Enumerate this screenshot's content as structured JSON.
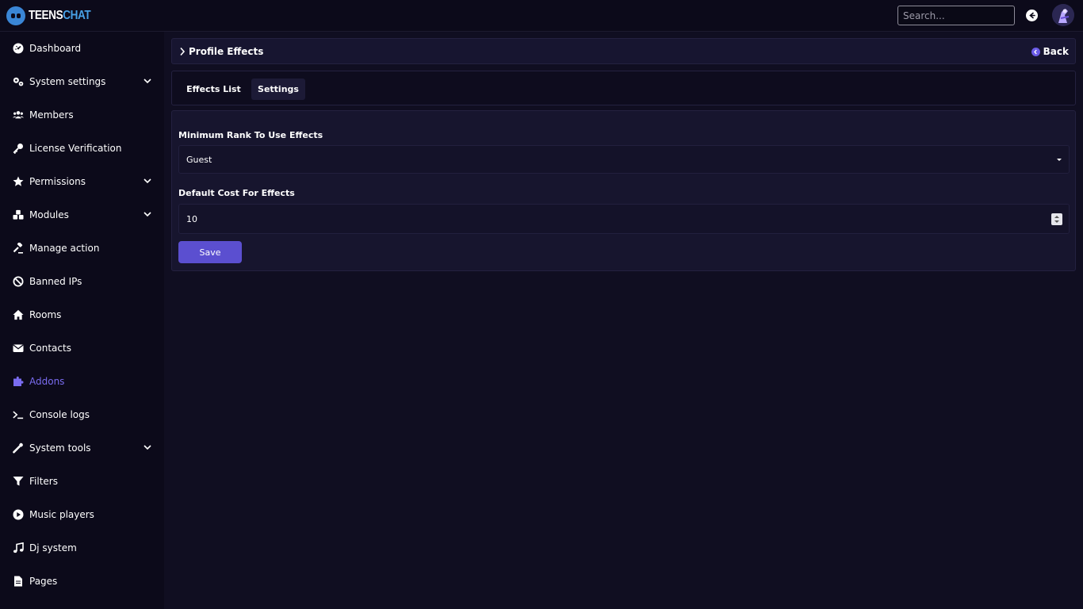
{
  "header": {
    "logo_part1": "TEENS",
    "logo_part2": "CHAT",
    "search_placeholder": "Search..."
  },
  "sidebar": {
    "items": [
      {
        "label": "Dashboard",
        "icon": "gauge-icon",
        "has_chevron": false
      },
      {
        "label": "System settings",
        "icon": "gears-icon",
        "has_chevron": true
      },
      {
        "label": "Members",
        "icon": "users-icon",
        "has_chevron": false
      },
      {
        "label": "License Verification",
        "icon": "key-icon",
        "has_chevron": false
      },
      {
        "label": "Permissions",
        "icon": "star-icon",
        "has_chevron": true
      },
      {
        "label": "Modules",
        "icon": "cubes-icon",
        "has_chevron": true
      },
      {
        "label": "Manage action",
        "icon": "gavel-icon",
        "has_chevron": false
      },
      {
        "label": "Banned IPs",
        "icon": "ban-icon",
        "has_chevron": false
      },
      {
        "label": "Rooms",
        "icon": "home-icon",
        "has_chevron": false
      },
      {
        "label": "Contacts",
        "icon": "envelope-icon",
        "has_chevron": false
      },
      {
        "label": "Addons",
        "icon": "puzzle-icon",
        "has_chevron": false,
        "active": true
      },
      {
        "label": "Console logs",
        "icon": "terminal-icon",
        "has_chevron": false
      },
      {
        "label": "System tools",
        "icon": "wrench-icon",
        "has_chevron": true
      },
      {
        "label": "Filters",
        "icon": "filter-icon",
        "has_chevron": false
      },
      {
        "label": "Music players",
        "icon": "play-circle-icon",
        "has_chevron": false
      },
      {
        "label": "Dj system",
        "icon": "music-icon",
        "has_chevron": false
      },
      {
        "label": "Pages",
        "icon": "file-icon",
        "has_chevron": false
      }
    ]
  },
  "breadcrumb": {
    "title": "Profile Effects",
    "back_label": "Back"
  },
  "tabs": {
    "effects_list": "Effects List",
    "settings": "Settings"
  },
  "form": {
    "min_rank_label": "Minimum Rank To Use Effects",
    "min_rank_value": "Guest",
    "default_cost_label": "Default Cost For Effects",
    "default_cost_value": "10",
    "save_label": "Save"
  },
  "colors": {
    "accent": "#5b4fd0",
    "active_nav": "#7a6cf0",
    "background": "#0e0c1d"
  }
}
